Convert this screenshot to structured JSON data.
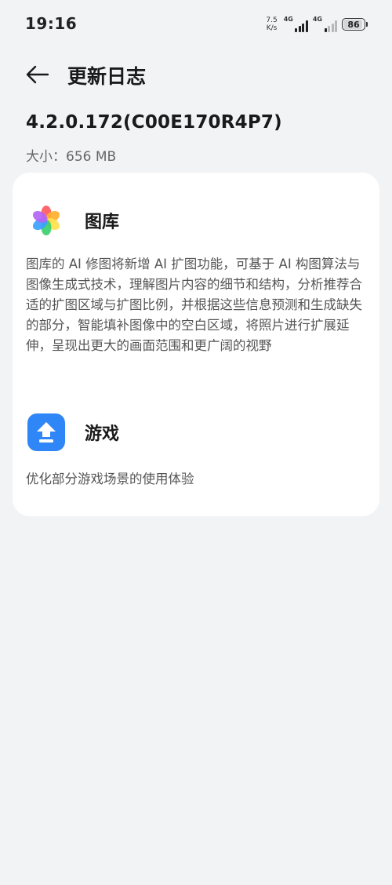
{
  "status_bar": {
    "time": "19:16",
    "net_speed_value": "7.5",
    "net_speed_unit": "K/s",
    "signal1_label": "4G",
    "signal2_label": "4G",
    "battery_level": "86"
  },
  "header": {
    "title": "更新日志",
    "back_icon": "arrow-left-icon"
  },
  "update": {
    "version": "4.2.0.172(C00E170R4P7)",
    "size_label": "大小：",
    "size_value": "656 MB"
  },
  "sections": [
    {
      "title": "图库",
      "icon": "gallery-icon",
      "body": "图库的 AI 修图将新增 AI 扩图功能，可基于 AI 构图算法与图像生成式技术，理解图片内容的细节和结构，分析推荐合适的扩图区域与扩图比例，并根据这些信息预测和生成缺失的部分，智能填补图像中的空白区域，将照片进行扩展延伸，呈现出更大的画面范围和更广阔的视野"
    },
    {
      "title": "游戏",
      "icon": "game-center-icon",
      "body": "优化部分游戏场景的使用体验"
    }
  ],
  "colors": {
    "background": "#f1f3f5",
    "card": "#ffffff",
    "game_icon_blue": "#2f86f6"
  }
}
